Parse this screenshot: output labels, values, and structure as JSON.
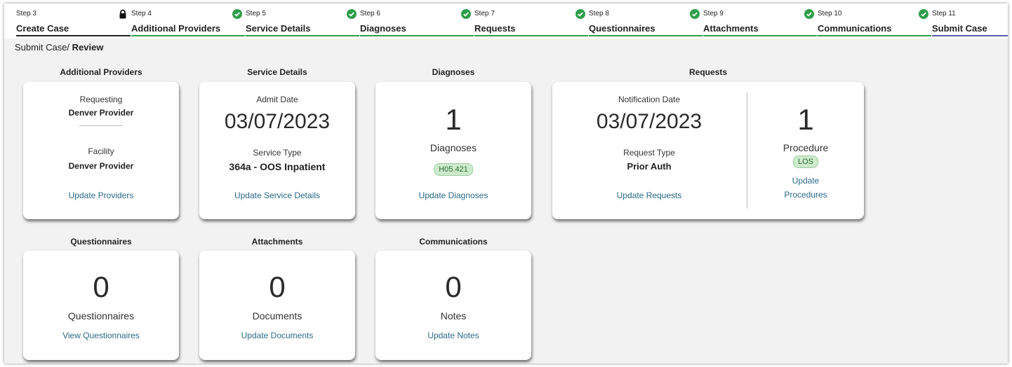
{
  "stepper": [
    {
      "step": "Step 3",
      "label": "Create Case",
      "status": "locked",
      "color": "#222222"
    },
    {
      "step": "Step 4",
      "label": "Additional Providers",
      "status": "complete",
      "color": "#2e9e4a"
    },
    {
      "step": "Step 5",
      "label": "Service Details",
      "status": "complete",
      "color": "#2e9e4a"
    },
    {
      "step": "Step 6",
      "label": "Diagnoses",
      "status": "complete",
      "color": "#2e9e4a"
    },
    {
      "step": "Step 7",
      "label": "Requests",
      "status": "complete",
      "color": "#2e9e4a"
    },
    {
      "step": "Step 8",
      "label": "Questionnaires",
      "status": "complete",
      "color": "#2e9e4a"
    },
    {
      "step": "Step 9",
      "label": "Attachments",
      "status": "complete",
      "color": "#2e9e4a"
    },
    {
      "step": "Step 10",
      "label": "Communications",
      "status": "complete",
      "color": "#2e9e4a"
    },
    {
      "step": "Step 11",
      "label": "Submit Case",
      "status": "current",
      "color": "#5a5aa8"
    }
  ],
  "breadcrumb": {
    "parent": "Submit Case/ ",
    "current": "Review"
  },
  "sections": {
    "additional_providers": {
      "title": "Additional Providers",
      "requesting_label": "Requesting",
      "requesting_value": "Denver Provider",
      "facility_label": "Facility",
      "facility_value": "Denver Provider",
      "link": "Update Providers"
    },
    "service_details": {
      "title": "Service Details",
      "admit_label": "Admit Date",
      "admit_value": "03/07/2023",
      "type_label": "Service Type",
      "type_value": "364a - OOS Inpatient",
      "link": "Update Service Details"
    },
    "diagnoses": {
      "title": "Diagnoses",
      "count": "1",
      "count_label": "Diagnoses",
      "chip": "H05.421",
      "link": "Update Diagnoses"
    },
    "requests": {
      "title": "Requests",
      "notif_label": "Notification Date",
      "notif_value": "03/07/2023",
      "type_label": "Request Type",
      "type_value": "Prior Auth",
      "link": "Update Requests",
      "proc_count": "1",
      "proc_label": "Procedure",
      "proc_chip": "LOS",
      "proc_link_1": "Update",
      "proc_link_2": "Procedures"
    },
    "questionnaires": {
      "title": "Questionnaires",
      "count": "0",
      "count_label": "Questionnaires",
      "link": "View Questionnaires"
    },
    "attachments": {
      "title": "Attachments",
      "count": "0",
      "count_label": "Documents",
      "link": "Update Documents"
    },
    "communications": {
      "title": "Communications",
      "count": "0",
      "count_label": "Notes",
      "link": "Update Notes"
    }
  }
}
